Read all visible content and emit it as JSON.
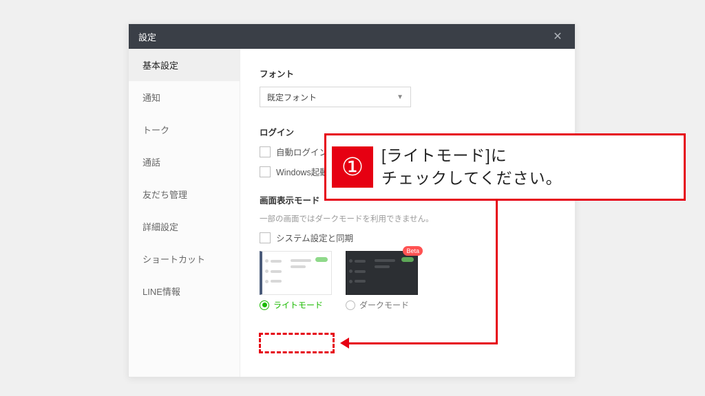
{
  "dialog": {
    "title": "設定"
  },
  "sidebar": {
    "items": [
      {
        "label": "基本設定",
        "active": true
      },
      {
        "label": "通知",
        "active": false
      },
      {
        "label": "トーク",
        "active": false
      },
      {
        "label": "通話",
        "active": false
      },
      {
        "label": "友だち管理",
        "active": false
      },
      {
        "label": "詳細設定",
        "active": false
      },
      {
        "label": "ショートカット",
        "active": false
      },
      {
        "label": "LINE情報",
        "active": false
      }
    ]
  },
  "content": {
    "font": {
      "label": "フォント",
      "selected": "既定フォント"
    },
    "login": {
      "label": "ログイン",
      "auto_login": "自動ログイン",
      "windows_startup": "Windows起動時"
    },
    "displayMode": {
      "label": "画面表示モード",
      "helper": "一部の画面ではダークモードを利用できません。",
      "sync_system": "システム設定と同期",
      "light_label": "ライトモード",
      "dark_label": "ダークモード",
      "beta_badge": "Beta"
    }
  },
  "annotation": {
    "number": "①",
    "text_line1": "[ライトモード]に",
    "text_line2": "チェックしてください。"
  }
}
